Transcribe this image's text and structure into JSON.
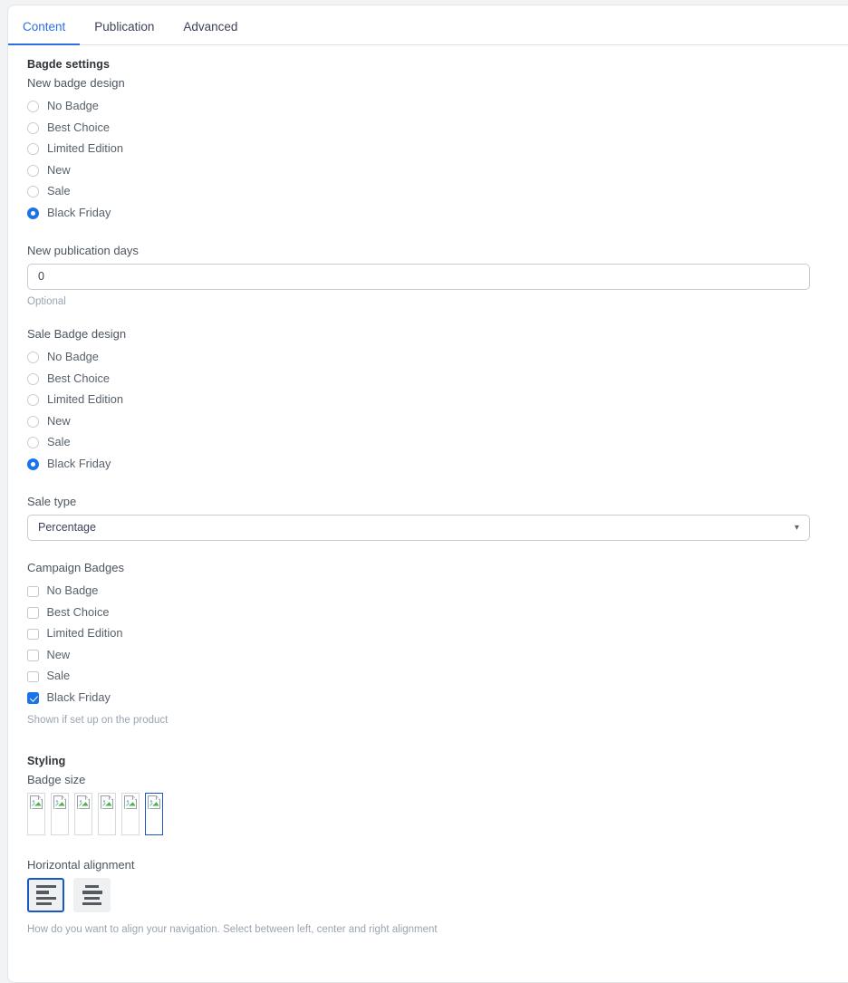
{
  "tabs": [
    {
      "label": "Content",
      "active": true
    },
    {
      "label": "Publication",
      "active": false
    },
    {
      "label": "Advanced",
      "active": false
    }
  ],
  "sections": {
    "badge_settings": {
      "heading": "Bagde settings",
      "new_badge_design": {
        "label": "New badge design",
        "options": [
          {
            "label": "No Badge",
            "selected": false
          },
          {
            "label": "Best Choice",
            "selected": false
          },
          {
            "label": "Limited Edition",
            "selected": false
          },
          {
            "label": "New",
            "selected": false
          },
          {
            "label": "Sale",
            "selected": false
          },
          {
            "label": "Black Friday",
            "selected": true
          }
        ]
      },
      "new_publication_days": {
        "label": "New publication days",
        "value": "0",
        "placeholder": "0",
        "help": "Optional"
      },
      "sale_badge_design": {
        "label": "Sale Badge design",
        "options": [
          {
            "label": "No Badge",
            "selected": false
          },
          {
            "label": "Best Choice",
            "selected": false
          },
          {
            "label": "Limited Edition",
            "selected": false
          },
          {
            "label": "New",
            "selected": false
          },
          {
            "label": "Sale",
            "selected": false
          },
          {
            "label": "Black Friday",
            "selected": true
          }
        ]
      },
      "sale_type": {
        "label": "Sale type",
        "value": "Percentage",
        "chevron": "chevron-down-icon"
      },
      "campaign_badges": {
        "label": "Campaign Badges",
        "options": [
          {
            "label": "No Badge",
            "checked": false
          },
          {
            "label": "Best Choice",
            "checked": false
          },
          {
            "label": "Limited Edition",
            "checked": false
          },
          {
            "label": "New",
            "checked": false
          },
          {
            "label": "Sale",
            "checked": false
          },
          {
            "label": "Black Friday",
            "checked": true
          }
        ],
        "help": "Shown if set up on the product"
      }
    },
    "styling": {
      "heading": "Styling",
      "badge_size": {
        "label": "Badge size",
        "swatches": [
          {
            "icon": "broken-image-icon",
            "selected": false
          },
          {
            "icon": "broken-image-icon",
            "selected": false
          },
          {
            "icon": "broken-image-icon",
            "selected": false
          },
          {
            "icon": "broken-image-icon",
            "selected": false
          },
          {
            "icon": "broken-image-icon",
            "selected": false
          },
          {
            "icon": "broken-image-icon",
            "selected": true
          }
        ]
      },
      "horizontal_alignment": {
        "label": "Horizontal alignment",
        "buttons": [
          {
            "icon": "align-left-icon",
            "selected": true
          },
          {
            "icon": "align-center-icon",
            "selected": false
          }
        ],
        "help": "How do you want to align your navigation. Select between left, center and right alignment"
      }
    }
  },
  "colors": {
    "accent": "#1a73e8",
    "tab_active": "#2f6fe4",
    "selected_border": "#1a56c4"
  }
}
